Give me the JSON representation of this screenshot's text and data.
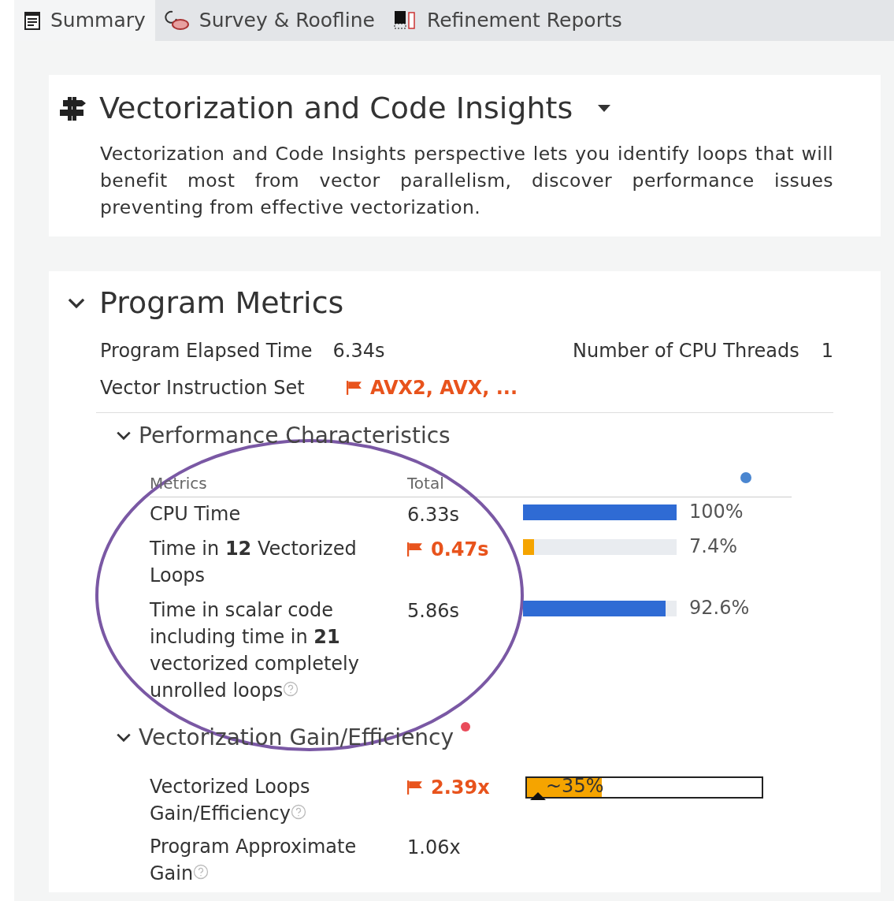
{
  "tabs": [
    {
      "label": "Summary",
      "selected": true
    },
    {
      "label": "Survey & Roofline",
      "selected": false
    },
    {
      "label": "Refinement Reports",
      "selected": false
    }
  ],
  "insights": {
    "title": "Vectorization and Code Insights",
    "description": "Vectorization and Code Insights perspective lets you identify loops that will benefit most from vector parallelism, discover performance issues preventing from effective vectorization."
  },
  "program_metrics": {
    "title": "Program Metrics",
    "expanded": true,
    "fields": [
      {
        "label": "Program Elapsed Time",
        "value": "6.34s",
        "flagged": false
      },
      {
        "label": "Number of CPU Threads",
        "value": "1",
        "flagged": false
      },
      {
        "label": "Vector Instruction Set",
        "value": "AVX2, AVX, ...",
        "flagged": true
      }
    ]
  },
  "performance": {
    "title": "Performance Characteristics",
    "expanded": true,
    "columns": [
      "Metrics",
      "Total"
    ],
    "rows": [
      {
        "label": "CPU Time",
        "help": false,
        "value": "6.33s",
        "flagged": false,
        "level": 1.0,
        "reading": "100%"
      },
      {
        "label": "Time in **12** Vectorized Loops",
        "help": false,
        "value": "0.47s",
        "flagged": true,
        "level": 0.074,
        "reading": "7.4%"
      },
      {
        "label": "Time in scalar code including time in **21** vectorized completely unrolled loops",
        "help": true,
        "value": "5.86s",
        "flagged": false,
        "level": 0.926,
        "reading": "92.6%"
      }
    ]
  },
  "gain": {
    "title": "Vectorization Gain/Efficiency",
    "expanded": true,
    "alert": true,
    "rows": [
      {
        "label": "Vectorized Loops Gain/Efficiency",
        "help": true,
        "value": "2.39x",
        "flagged": true,
        "kind": "gauge",
        "level": 0.32,
        "reading": "~35%"
      },
      {
        "label": "Program Approximate Gain",
        "help": true,
        "value": "1.06x",
        "flagged": false,
        "kind": "plain"
      }
    ]
  }
}
